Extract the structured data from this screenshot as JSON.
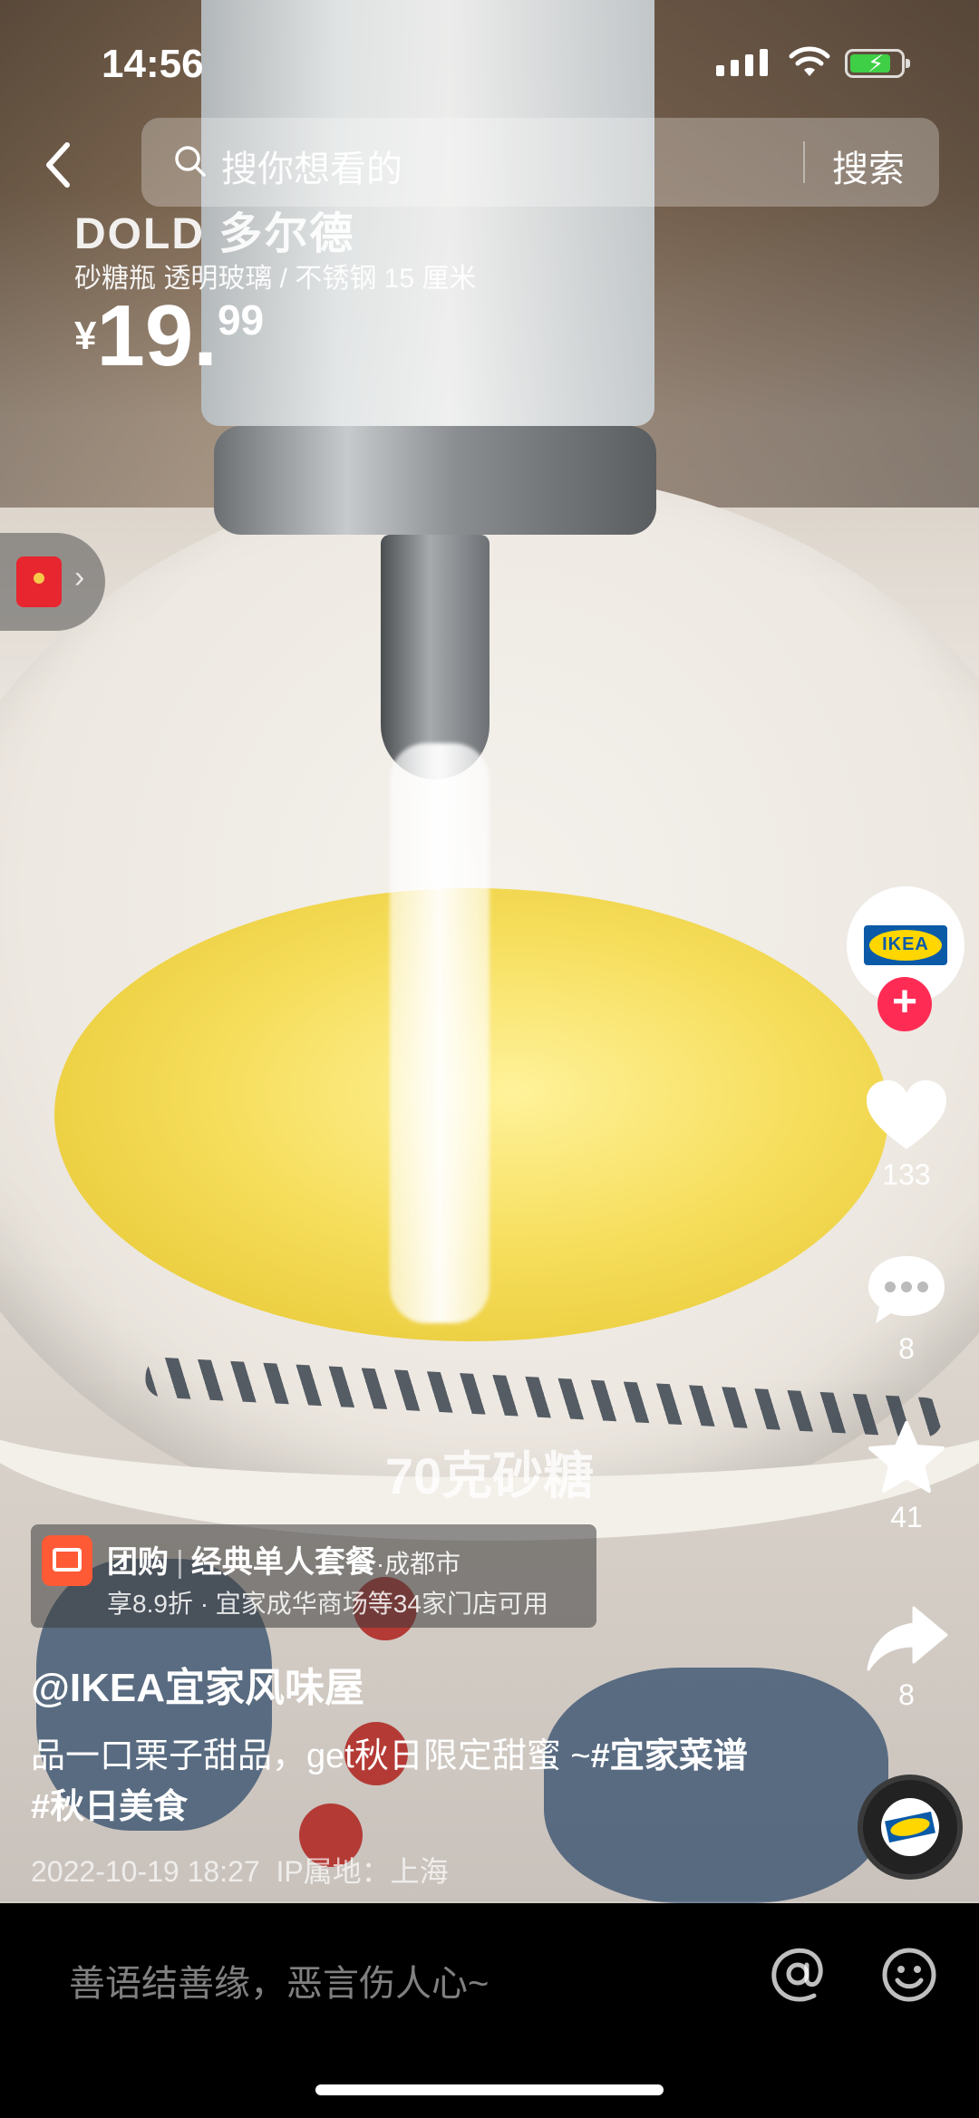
{
  "status_bar": {
    "time": "14:56"
  },
  "search": {
    "placeholder": "搜你想看的",
    "button": "搜索"
  },
  "product": {
    "name": "DOLD 多尔德",
    "description": "砂糖瓶 透明玻璃 / 不锈钢 15 厘米",
    "price_currency": "¥",
    "price_int": "19.",
    "price_dec": "99"
  },
  "author_avatar": {
    "logo_text": "IKEA"
  },
  "actions": {
    "likes": "133",
    "comments": "8",
    "favorites": "41",
    "shares": "8"
  },
  "video_caption": "70克砂糖",
  "group_buy": {
    "label": "团购",
    "package": "经典单人套餐",
    "city": "·成都市",
    "offer": "享8.9折 · 宜家成华商场等34家门店可用"
  },
  "post": {
    "author": "@IKEA宜家风味屋",
    "text": "品一口栗子甜品，get秋日限定甜蜜 ~",
    "tag1": "#宜家菜谱",
    "tag2": "#秋日美食",
    "date": "2022-10-19 18:27",
    "ip": "IP属地：上海"
  },
  "comment_bar": {
    "placeholder": "善语结善缘，恶言伤人心~"
  },
  "colors": {
    "follow": "#fe2c55",
    "battery": "#3fcf46",
    "groupbuy_icon": "#ff5a36"
  }
}
